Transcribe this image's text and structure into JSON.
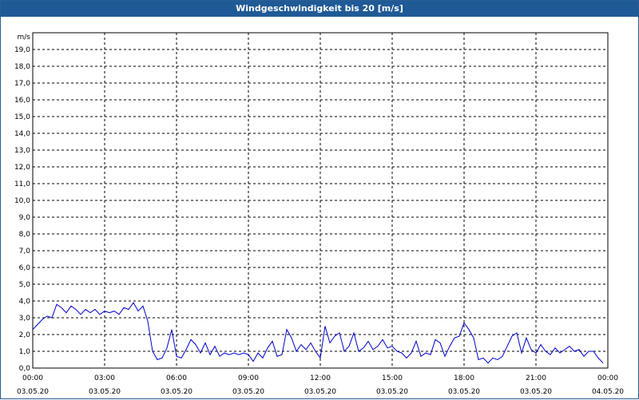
{
  "window": {
    "title": "Windgeschwindigkeit bis 20 [m/s]"
  },
  "chart_data": {
    "type": "line",
    "title": "Windgeschwindigkeit bis 20 [m/s]",
    "ylabel": "m/s",
    "xlabel": "",
    "ylim": [
      0,
      20
    ],
    "xlim_hours": [
      0,
      24
    ],
    "grid": true,
    "y_ticks": [
      "0,0",
      "1,0",
      "2,0",
      "3,0",
      "4,0",
      "5,0",
      "6,0",
      "7,0",
      "8,0",
      "9,0",
      "10,0",
      "11,0",
      "12,0",
      "13,0",
      "14,0",
      "15,0",
      "16,0",
      "17,0",
      "18,0",
      "19,0"
    ],
    "x_ticks": [
      {
        "time": "00:00",
        "date": "03.05.20"
      },
      {
        "time": "03:00",
        "date": "03.05.20"
      },
      {
        "time": "06:00",
        "date": "03.05.20"
      },
      {
        "time": "09:00",
        "date": "03.05.20"
      },
      {
        "time": "12:00",
        "date": "03.05.20"
      },
      {
        "time": "15:00",
        "date": "03.05.20"
      },
      {
        "time": "18:00",
        "date": "03.05.20"
      },
      {
        "time": "21:00",
        "date": "03.05.20"
      },
      {
        "time": "00:00",
        "date": "04.05.20"
      }
    ],
    "line_color": "#0000cc",
    "series": [
      {
        "x": [
          0.0,
          0.2,
          0.4,
          0.6,
          0.8,
          1.0,
          1.2,
          1.4,
          1.6,
          1.8,
          2.0,
          2.2,
          2.4,
          2.6,
          2.8,
          3.0,
          3.2,
          3.4,
          3.6,
          3.8,
          4.0,
          4.2,
          4.4,
          4.6,
          4.8,
          5.0,
          5.2,
          5.4,
          5.6,
          5.8,
          6.0,
          6.2,
          6.4,
          6.6,
          6.8,
          7.0,
          7.2,
          7.4,
          7.6,
          7.8,
          8.0,
          8.2,
          8.4,
          8.6,
          8.8,
          9.0,
          9.2,
          9.4,
          9.6,
          9.8,
          10.0,
          10.2,
          10.4,
          10.6,
          10.8,
          11.0,
          11.2,
          11.4,
          11.6,
          11.8,
          12.0,
          12.2,
          12.4,
          12.6,
          12.8,
          13.0,
          13.2,
          13.4,
          13.6,
          13.8,
          14.0,
          14.2,
          14.4,
          14.6,
          14.8,
          15.0,
          15.2,
          15.4,
          15.6,
          15.8,
          16.0,
          16.2,
          16.4,
          16.6,
          16.8,
          17.0,
          17.2,
          17.4,
          17.6,
          17.8,
          18.0,
          18.2,
          18.4,
          18.6,
          18.8,
          19.0,
          19.2,
          19.4,
          19.6,
          19.8,
          20.0,
          20.2,
          20.4,
          20.6,
          20.8,
          21.0,
          21.2,
          21.4,
          21.6,
          21.8,
          22.0,
          22.2,
          22.4,
          22.6,
          22.8,
          23.0,
          23.2,
          23.4,
          23.6,
          23.8
        ],
        "values": [
          2.3,
          2.6,
          2.9,
          3.1,
          3.0,
          3.8,
          3.6,
          3.3,
          3.7,
          3.5,
          3.2,
          3.5,
          3.3,
          3.5,
          3.2,
          3.4,
          3.3,
          3.4,
          3.2,
          3.6,
          3.5,
          3.9,
          3.4,
          3.7,
          2.8,
          1.0,
          0.5,
          0.6,
          1.2,
          2.3,
          0.7,
          0.6,
          1.1,
          1.7,
          1.4,
          0.9,
          1.5,
          0.8,
          1.3,
          0.7,
          0.9,
          0.8,
          0.9,
          0.8,
          0.9,
          0.8,
          0.4,
          0.9,
          0.6,
          1.2,
          1.6,
          0.7,
          0.8,
          2.3,
          1.8,
          1.0,
          1.4,
          1.1,
          1.5,
          1.0,
          0.6,
          2.5,
          1.5,
          1.9,
          2.1,
          1.0,
          1.3,
          2.1,
          1.0,
          1.2,
          1.6,
          1.1,
          1.3,
          1.7,
          1.2,
          1.3,
          1.0,
          0.9,
          0.6,
          0.9,
          1.6,
          0.7,
          0.9,
          0.8,
          1.7,
          1.5,
          0.7,
          1.3,
          1.8,
          1.9,
          2.7,
          2.3,
          1.8,
          0.5,
          0.6,
          0.3,
          0.6,
          0.5,
          0.7,
          1.3,
          1.9,
          2.1,
          0.9,
          1.8,
          1.1,
          0.9,
          1.4,
          1.0,
          0.8,
          1.2,
          0.9,
          1.1,
          1.3,
          1.0,
          1.1,
          0.7,
          1.0,
          1.0,
          0.6,
          0.3
        ]
      }
    ]
  }
}
